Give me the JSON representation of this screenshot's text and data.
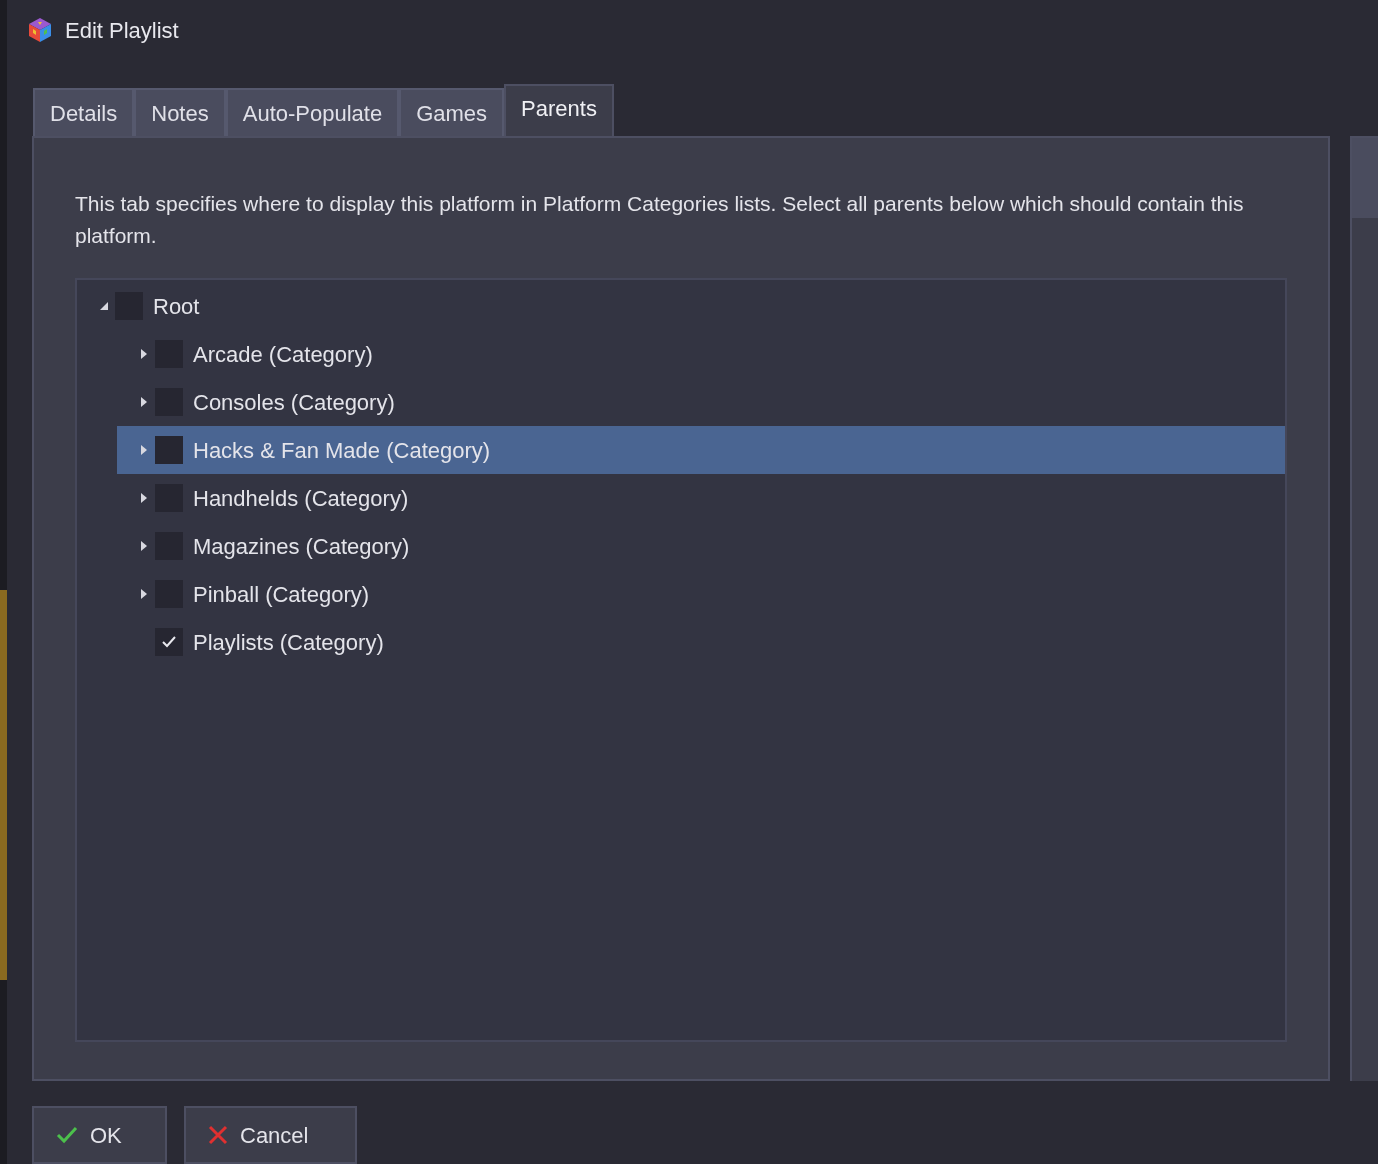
{
  "window": {
    "title": "Edit Playlist"
  },
  "tabs": [
    {
      "label": "Details",
      "selected": false
    },
    {
      "label": "Notes",
      "selected": false
    },
    {
      "label": "Auto-Populate",
      "selected": false
    },
    {
      "label": "Games",
      "selected": false
    },
    {
      "label": "Parents",
      "selected": true
    }
  ],
  "description": "This tab specifies where to display this platform in Platform Categories lists. Select all parents below which should contain this platform.",
  "tree": [
    {
      "label": "Root",
      "has_children": true,
      "expanded": true,
      "checked": false,
      "selected": false,
      "children": [
        {
          "label": "Arcade (Category)",
          "has_children": true,
          "expanded": false,
          "checked": false,
          "selected": false
        },
        {
          "label": "Consoles (Category)",
          "has_children": true,
          "expanded": false,
          "checked": false,
          "selected": false
        },
        {
          "label": "Hacks & Fan Made (Category)",
          "has_children": true,
          "expanded": false,
          "checked": false,
          "selected": true
        },
        {
          "label": "Handhelds (Category)",
          "has_children": true,
          "expanded": false,
          "checked": false,
          "selected": false
        },
        {
          "label": "Magazines (Category)",
          "has_children": true,
          "expanded": false,
          "checked": false,
          "selected": false
        },
        {
          "label": "Pinball (Category)",
          "has_children": true,
          "expanded": false,
          "checked": false,
          "selected": false
        },
        {
          "label": "Playlists (Category)",
          "has_children": false,
          "expanded": false,
          "checked": true,
          "selected": false
        }
      ]
    }
  ],
  "buttons": [
    {
      "label": "OK",
      "kind": "ok"
    },
    {
      "label": "Cancel",
      "kind": "cancel"
    }
  ]
}
